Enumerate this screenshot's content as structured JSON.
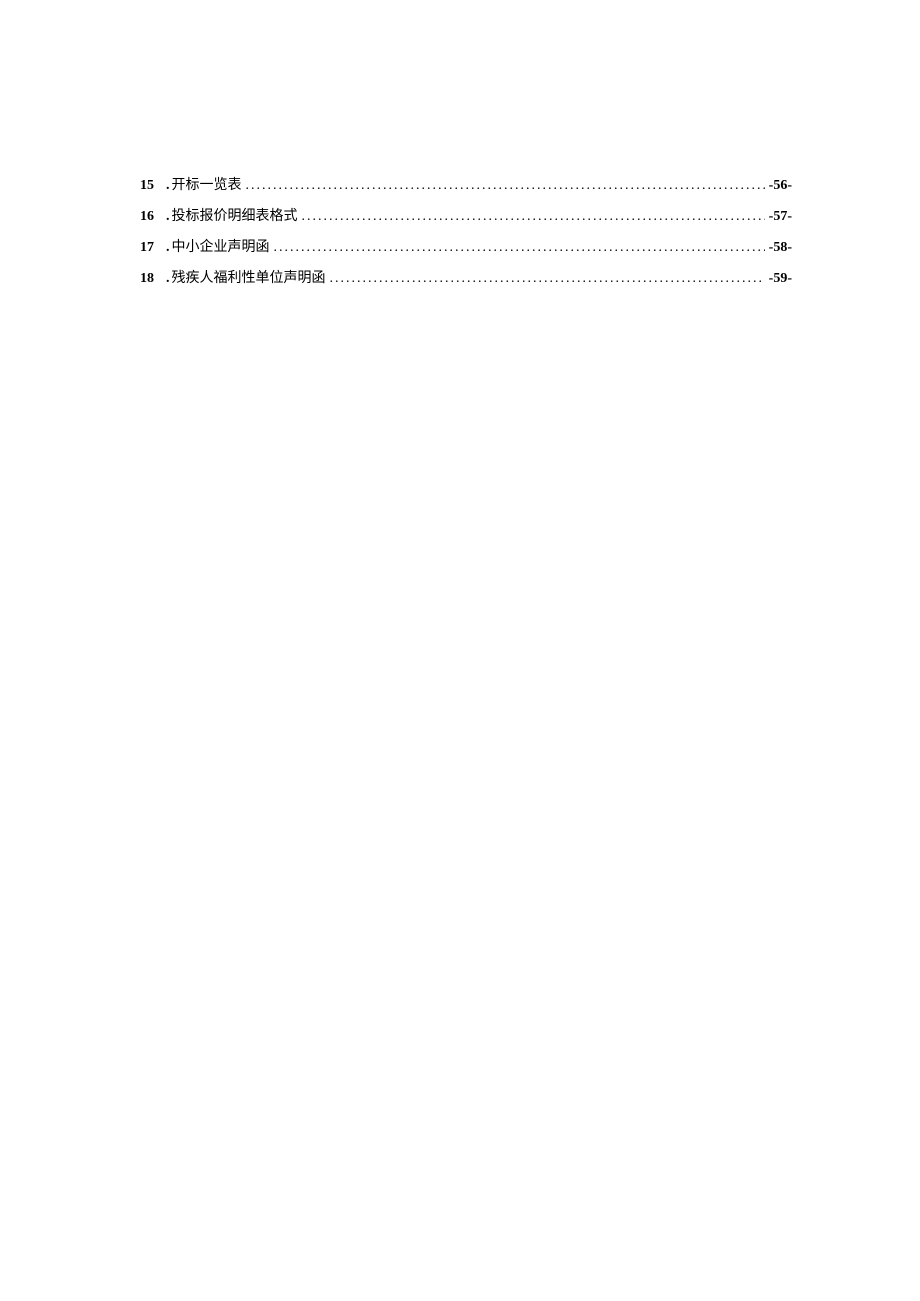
{
  "toc": {
    "entries": [
      {
        "number": "15",
        "prefix": ".",
        "title": "开标一览表",
        "page": "-56-"
      },
      {
        "number": "16",
        "prefix": ".",
        "title": "投标报价明细表格式",
        "page": "-57-"
      },
      {
        "number": "17",
        "prefix": ".",
        "title": "中小企业声明函",
        "page": "-58-"
      },
      {
        "number": "18",
        "prefix": ".",
        "title": "残疾人福利性单位声明函",
        "page": "-59-"
      }
    ]
  }
}
